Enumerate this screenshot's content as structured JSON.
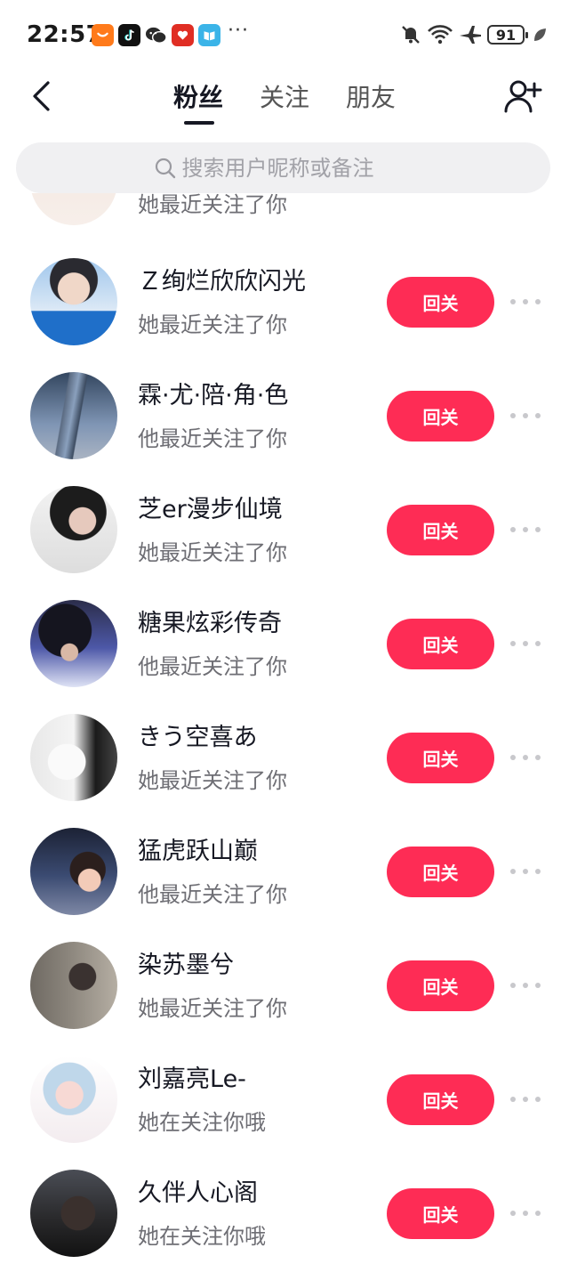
{
  "status_bar": {
    "time": "22:57",
    "more": "···",
    "battery": "91",
    "app_icons": [
      "taobao-icon",
      "tiktok-icon",
      "wechat-icon",
      "pinduoduo-icon",
      "reader-icon"
    ],
    "status_icons": [
      "mute-icon",
      "wifi-icon",
      "airplane-icon",
      "battery-icon",
      "leaf-icon"
    ]
  },
  "header": {
    "tabs": [
      {
        "label": "粉丝",
        "active": true
      },
      {
        "label": "关注",
        "active": false
      },
      {
        "label": "朋友",
        "active": false
      }
    ]
  },
  "search": {
    "placeholder": "搜索用户昵称或备注"
  },
  "colors": {
    "accent": "#fe2c55",
    "text_primary": "#161823",
    "text_secondary": "#6e6e74",
    "search_bg": "#f0f0f2"
  },
  "list": {
    "partial_item": {
      "subtitle": "她最近关注了你"
    },
    "items": [
      {
        "name": "Ｚ绚烂欣欣闪光",
        "subtitle": "她最近关注了你",
        "button": "回关"
      },
      {
        "name": "霖·尤·陪·角·色",
        "subtitle": "他最近关注了你",
        "button": "回关"
      },
      {
        "name": "芝er漫步仙境",
        "subtitle": "她最近关注了你",
        "button": "回关"
      },
      {
        "name": "糖果炫彩传奇",
        "subtitle": "他最近关注了你",
        "button": "回关"
      },
      {
        "name": "きう空喜あ",
        "subtitle": "她最近关注了你",
        "button": "回关"
      },
      {
        "name": "猛虎跃山巅",
        "subtitle": "他最近关注了你",
        "button": "回关"
      },
      {
        "name": "染苏墨兮",
        "subtitle": "她最近关注了你",
        "button": "回关"
      },
      {
        "name": "刘嘉亮Le-",
        "subtitle": "她在关注你哦",
        "button": "回关"
      },
      {
        "name": "久伴人心阁",
        "subtitle": "她在关注你哦",
        "button": "回关"
      }
    ]
  }
}
